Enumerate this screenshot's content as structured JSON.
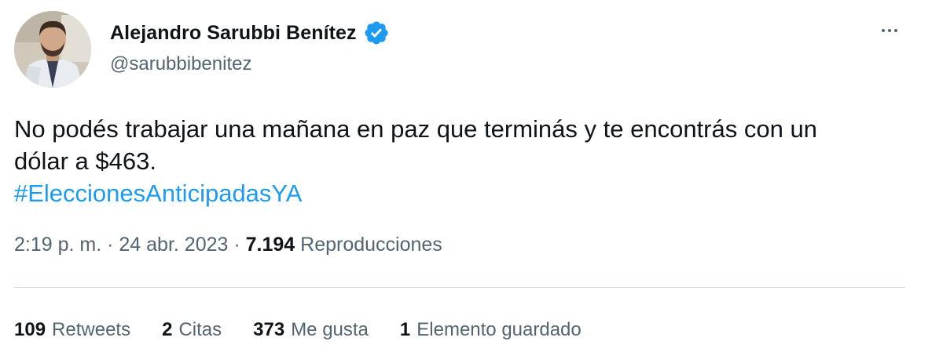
{
  "author": {
    "name": "Alejandro Sarubbi Benítez",
    "handle": "@sarubbibenitez",
    "verified_color": "#1d9bf0"
  },
  "tweet": {
    "line1": "No podés trabajar una mañana en paz que terminás y te encontrás con un",
    "line2": "dólar a $463.",
    "hashtag": "#EleccionesAnticipadasYA"
  },
  "meta": {
    "time": "2:19 p. m.",
    "separator1": " · ",
    "date": "24 abr. 2023",
    "separator2": " · ",
    "views_count": "7.194",
    "views_label": " Reproducciones"
  },
  "stats": [
    {
      "count": "109",
      "label": "Retweets"
    },
    {
      "count": "2",
      "label": "Citas"
    },
    {
      "count": "373",
      "label": "Me gusta"
    },
    {
      "count": "1",
      "label": "Elemento guardado"
    }
  ],
  "icons": {
    "verified": "verified-badge-icon",
    "more": "more-options-icon"
  },
  "colors": {
    "text": "#0f1419",
    "secondary": "#536471",
    "link": "#1d9bf0",
    "divider": "#cfd9de"
  }
}
